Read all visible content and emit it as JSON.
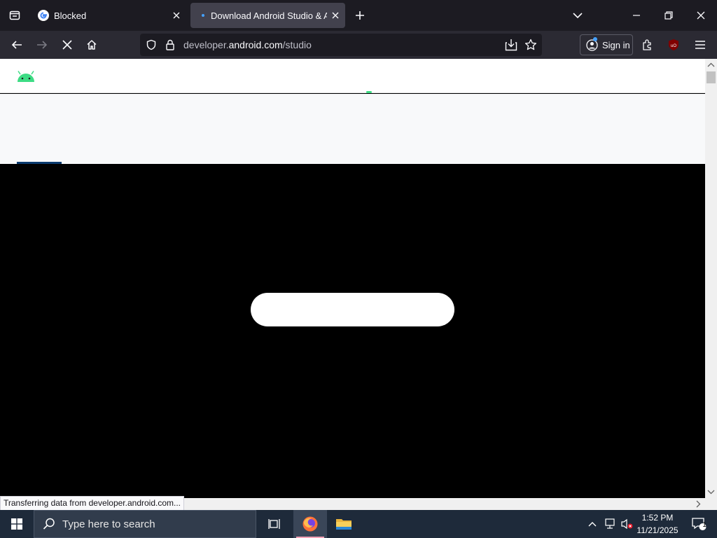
{
  "browser": {
    "tabs": [
      {
        "title": "Blocked",
        "icon": "google-g-icon"
      },
      {
        "title": "Download Android Studio & App",
        "icon": "loading-dot-icon"
      }
    ],
    "url": {
      "prefix": "developer.",
      "host": "android.com",
      "path": "/studio"
    },
    "sign_in_label": "Sign in",
    "status_text": "Transferring data from developer.android.com..."
  },
  "taskbar": {
    "search_placeholder": "Type here to search",
    "time": "1:52 PM",
    "date": "11/21/2025",
    "notification_count": "1"
  },
  "colors": {
    "tab_strip": "#1c1b22",
    "nav_bar": "#2b2a33",
    "active_tab": "#42414d",
    "android_green": "#3ddc84",
    "taskbar": "#1e2a3a"
  }
}
